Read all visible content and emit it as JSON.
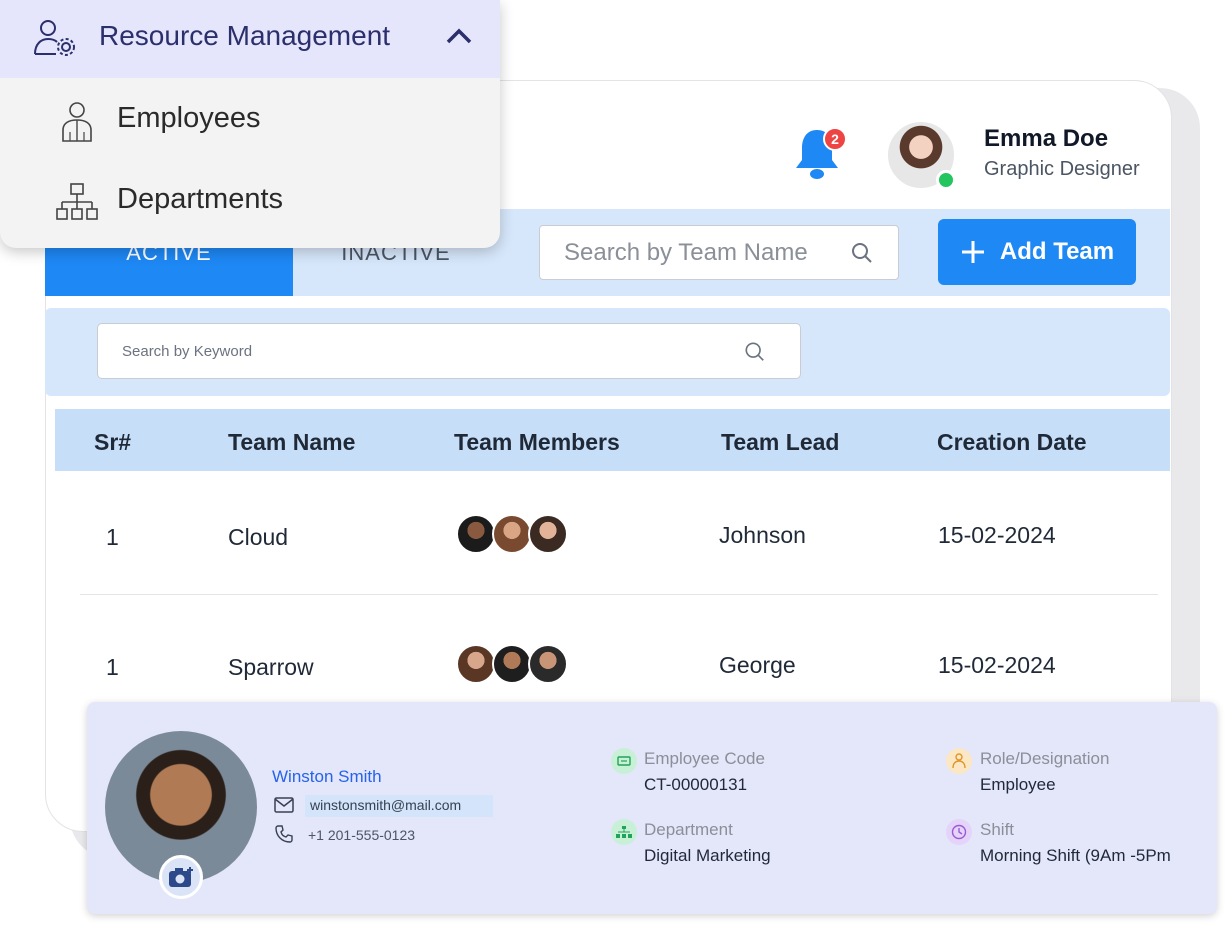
{
  "menu": {
    "title": "Resource Management",
    "items": [
      {
        "label": "Employees",
        "icon": "employee-icon"
      },
      {
        "label": "Departments",
        "icon": "org-chart-icon"
      }
    ]
  },
  "header": {
    "notification_count": "2",
    "user_name": "Emma Doe",
    "user_role": "Graphic Designer"
  },
  "tabs": {
    "active": "ACTIVE",
    "inactive": "INACTIVE"
  },
  "search": {
    "team_placeholder": "Search by Team Name",
    "keyword_placeholder": "Search by Keyword"
  },
  "add_team_label": "Add Team",
  "table": {
    "headers": [
      "Sr#",
      "Team Name",
      "Team Members",
      "Team Lead",
      "Creation Date"
    ],
    "rows": [
      {
        "sr": "1",
        "team": "Cloud",
        "lead": "Johnson",
        "date": "15-02-2024"
      },
      {
        "sr": "1",
        "team": "Sparrow",
        "lead": "George",
        "date": "15-02-2024"
      }
    ]
  },
  "profile": {
    "name": "Winston Smith",
    "email": "winstonsmith@mail.com",
    "phone": "+1 201-555-0123",
    "employee_code_label": "Employee Code",
    "employee_code": "CT-00000131",
    "department_label": "Department",
    "department": "Digital Marketing",
    "role_label": "Role/Designation",
    "role": "Employee",
    "shift_label": "Shift",
    "shift": "Morning Shift (9Am -5Pm"
  },
  "colors": {
    "primary": "#1e88f5",
    "menu_header": "#e5e5fb",
    "table_header": "#c6def8",
    "badge": "#ef4444",
    "online": "#22c55e"
  }
}
